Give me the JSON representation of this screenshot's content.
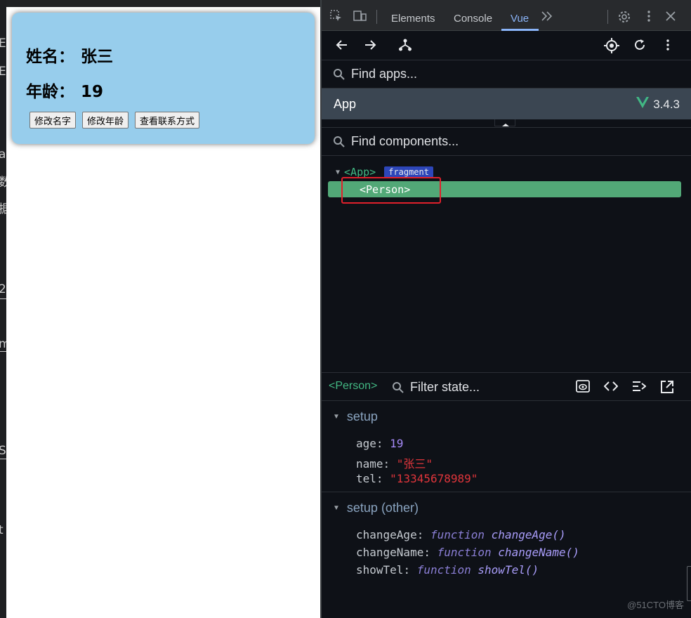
{
  "editor_strip": {
    "glyphs": [
      "E",
      "E",
      "a",
      "数",
      "据",
      "2",
      "m",
      "S",
      "t"
    ]
  },
  "page": {
    "card": {
      "name_label": "姓名：",
      "name_value": "张三",
      "age_label": "年龄：",
      "age_value": "19",
      "buttons": [
        "修改名字",
        "修改年龄",
        "查看联系方式"
      ]
    }
  },
  "devtools": {
    "tabs": [
      "Elements",
      "Console",
      "Vue"
    ],
    "active_tab": "Vue",
    "find_apps_placeholder": "Find apps...",
    "app_name": "App",
    "vue_version": "3.4.3",
    "find_components_placeholder": "Find components...",
    "tree": {
      "root": "<App>",
      "root_badge": "fragment",
      "selected": "<Person>"
    },
    "state": {
      "component": "<Person>",
      "filter_placeholder": "Filter state...",
      "sections": [
        {
          "title": "setup",
          "props": [
            {
              "key": "age",
              "value": "19"
            },
            {
              "key": "name",
              "value": "\"张三\""
            },
            {
              "key": "tel",
              "value": "\"13345678989\""
            }
          ]
        },
        {
          "title": "setup (other)",
          "props": [
            {
              "key": "changeAge",
              "kind": "function",
              "value": "changeAge()"
            },
            {
              "key": "changeName",
              "kind": "function",
              "value": "changeName()"
            },
            {
              "key": "showTel",
              "kind": "function",
              "value": "showTel()"
            }
          ]
        }
      ]
    },
    "watermark": "@51CTO博客"
  },
  "colors": {
    "vue_green": "#42b883",
    "selected_row": "#52a877",
    "card_bg": "#97cdec",
    "highlight_border": "#e0202b",
    "string_value": "#e0353b",
    "number_value": "#a78bfa"
  }
}
